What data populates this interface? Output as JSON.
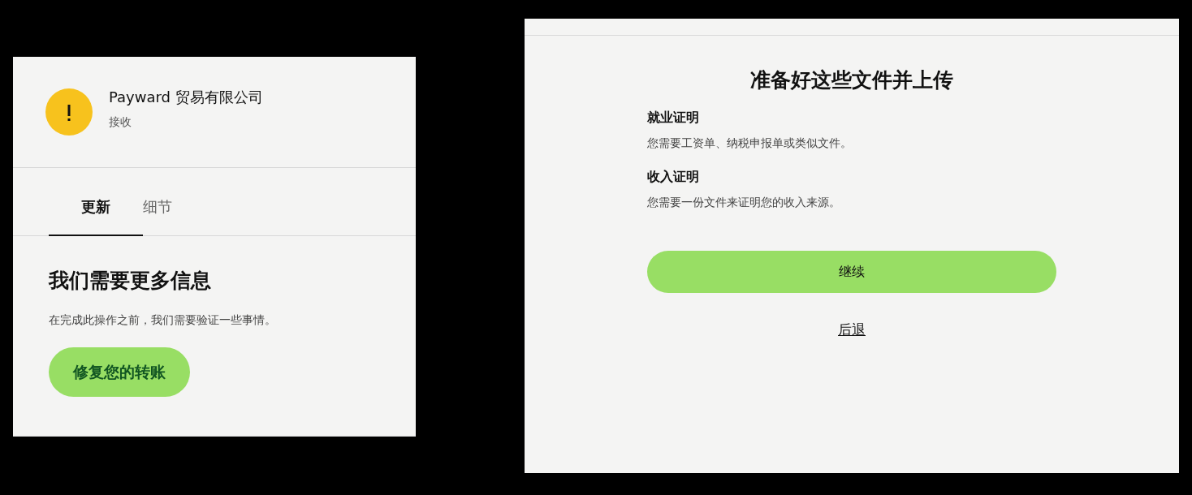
{
  "transfer_panel": {
    "company": "Payward 贸易有限公司",
    "direction": "接收",
    "tabs": [
      {
        "label": "更新",
        "selected": true
      },
      {
        "label": "细节",
        "selected": false
      }
    ],
    "heading": "我们需要更多信息",
    "message": "在完成此操作之前，我们需要验证一些事情。",
    "action_button": "修复您的转账"
  },
  "upload_panel": {
    "title": "准备好这些文件并上传",
    "requirements": [
      {
        "title": "就业证明",
        "description": "您需要工资单、纳税申报单或类似文件。"
      },
      {
        "title": "收入证明",
        "description": "您需要一份文件来证明您的收入来源。"
      }
    ],
    "continue_button": "继续",
    "back_link": "后退"
  }
}
